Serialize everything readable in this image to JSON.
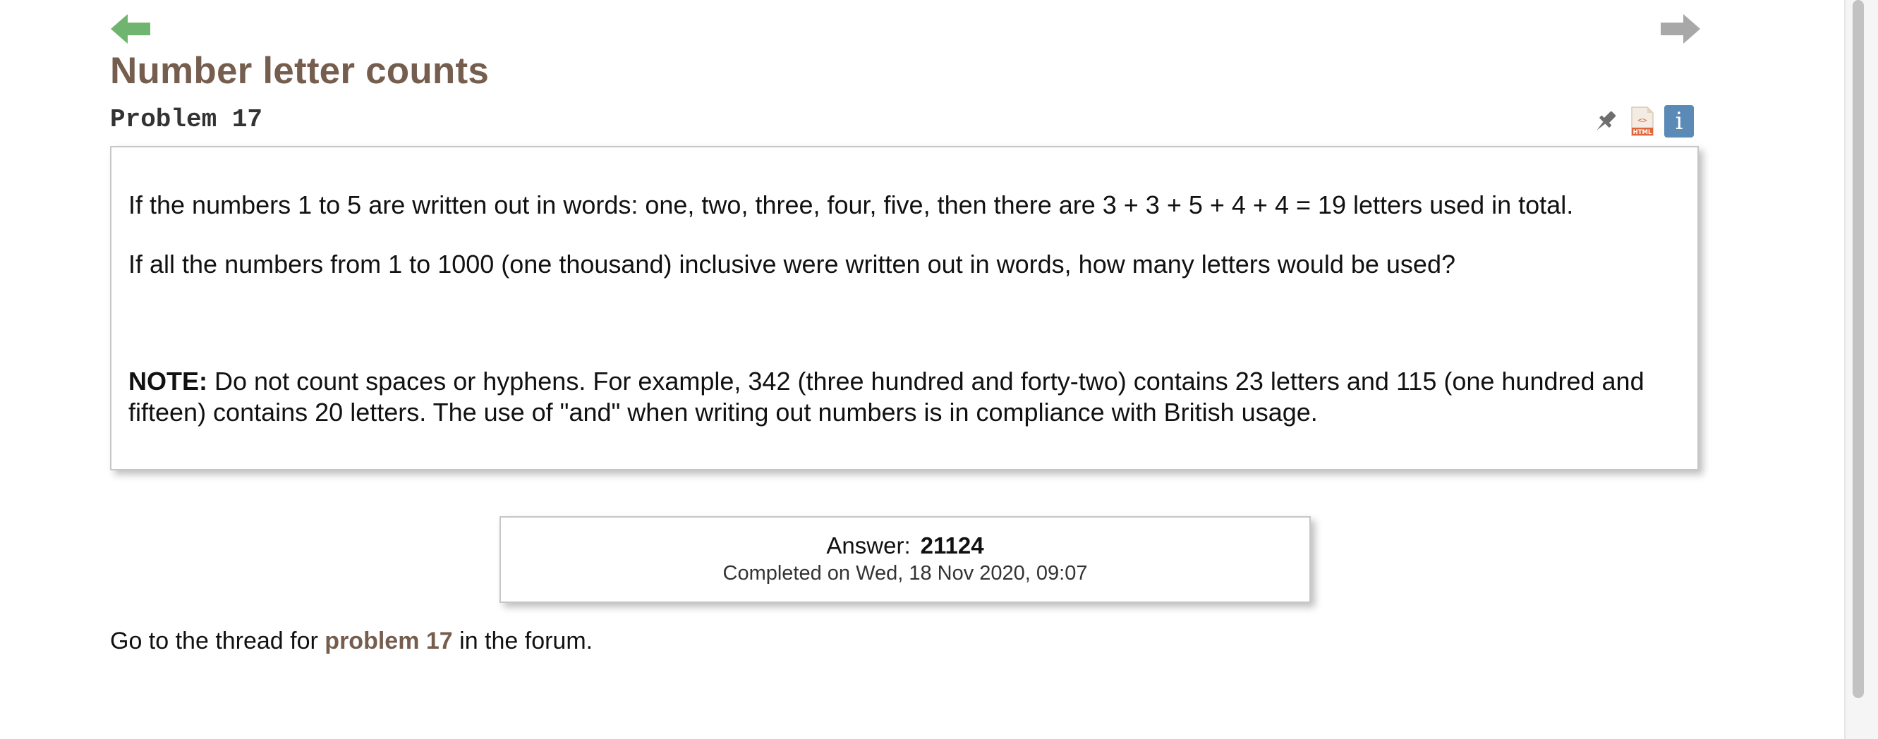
{
  "nav": {
    "prev_icon": "arrow-left-icon",
    "next_icon": "arrow-right-icon",
    "prev_color": "#6fb56f",
    "next_color": "#a8a8a8"
  },
  "problem": {
    "title": "Number letter counts",
    "subtitle": "Problem 17",
    "paragraph1": "If the numbers 1 to 5 are written out in words: one, two, three, four, five, then there are 3 + 3 + 5 + 4 + 4 = 19 letters used in total.",
    "paragraph2": "If all the numbers from 1 to 1000 (one thousand) inclusive were written out in words, how many letters would be used?",
    "note_label": "NOTE:",
    "note_text": " Do not count spaces or hyphens. For example, 342 (three hundred and forty-two) contains 23 letters and 115 (one hundred and fifteen) contains 20 letters. The use of \"and\" when writing out numbers is in compliance with British usage."
  },
  "tools": {
    "pin_icon": "pin-icon",
    "html_icon": "html-file-icon",
    "html_badge": "HTML",
    "info_icon": "info-icon",
    "info_glyph": "i"
  },
  "answer": {
    "label": "Answer:",
    "value": "21124",
    "completed": "Completed on Wed, 18 Nov 2020, 09:07"
  },
  "forum": {
    "prefix": "Go to the thread for ",
    "link_text": "problem 17",
    "suffix": " in the forum."
  },
  "colors": {
    "title_brown": "#755e4e",
    "info_blue": "#5a8ab5",
    "border_gray": "#c7c7c7"
  }
}
